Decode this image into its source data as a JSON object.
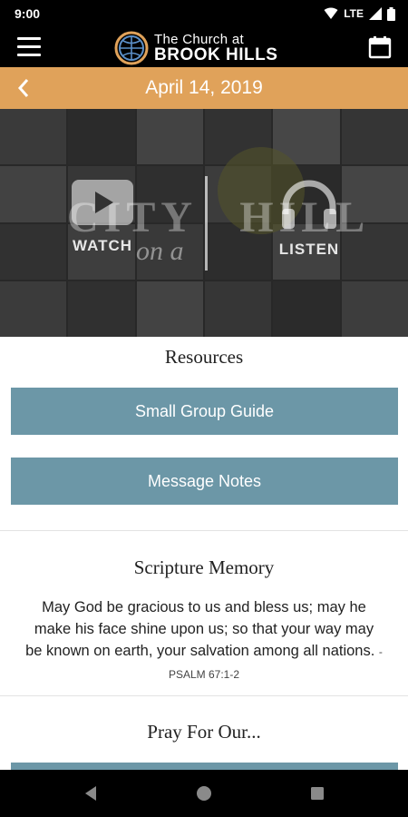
{
  "status": {
    "time": "9:00",
    "network": "LTE"
  },
  "header": {
    "logo_line1": "The Church at",
    "logo_line2": "BROOK HILLS"
  },
  "datebar": {
    "date": "April 14, 2019"
  },
  "hero": {
    "title_text": "CITY",
    "title_text_2": "HILL",
    "subtitle_text": "on a",
    "watch_label": "WATCH",
    "listen_label": "LISTEN"
  },
  "resources": {
    "title": "Resources",
    "small_group_guide": "Small Group Guide",
    "message_notes": "Message Notes"
  },
  "scripture": {
    "title": "Scripture Memory",
    "verse": "May God be gracious to us and bless us; may he make his face shine upon us; so that your way may be known on earth, your salvation among all nations. ",
    "reference": "- PSALM 67:1-2"
  },
  "pray": {
    "title": "Pray For Our..."
  },
  "colors": {
    "accent": "#e0a25a",
    "button": "#6c97a7",
    "bar": "#000000"
  }
}
